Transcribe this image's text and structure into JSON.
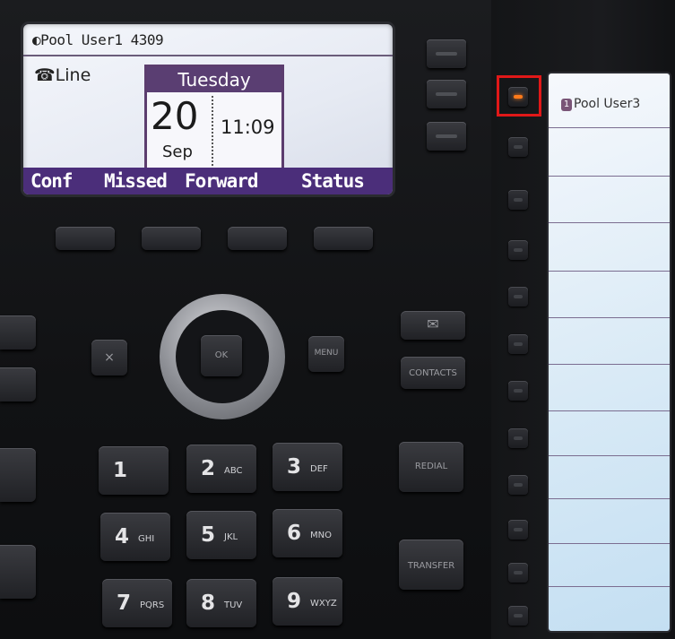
{
  "lcd": {
    "title": "◐Pool User1 4309",
    "line_label": "☎Line",
    "day": "Tuesday",
    "date": "20",
    "month": "Sep",
    "time": "11:09",
    "softkeys": [
      "Conf",
      "Missed",
      "Forward",
      "Status"
    ]
  },
  "side_panel": {
    "badge": "1",
    "first_label": "Pool User3"
  },
  "nav": {
    "ok": "OK",
    "menu": "MENU",
    "cancel": "×"
  },
  "function_keys": {
    "contacts": "CONTACTS",
    "redial": "REDIAL",
    "transfer": "TRANSFER",
    "message_icon": "✉"
  },
  "keypad": [
    {
      "digit": "1",
      "letters": ""
    },
    {
      "digit": "2",
      "letters": "ABC"
    },
    {
      "digit": "3",
      "letters": "DEF"
    },
    {
      "digit": "4",
      "letters": "GHI"
    },
    {
      "digit": "5",
      "letters": "JKL"
    },
    {
      "digit": "6",
      "letters": "MNO"
    },
    {
      "digit": "7",
      "letters": "PQRS"
    },
    {
      "digit": "8",
      "letters": "TUV"
    },
    {
      "digit": "9",
      "letters": "WXYZ"
    }
  ],
  "colors": {
    "lcd_accent": "#4b2e7a",
    "led_active": "#ff7a1a",
    "highlight": "#e01818"
  }
}
